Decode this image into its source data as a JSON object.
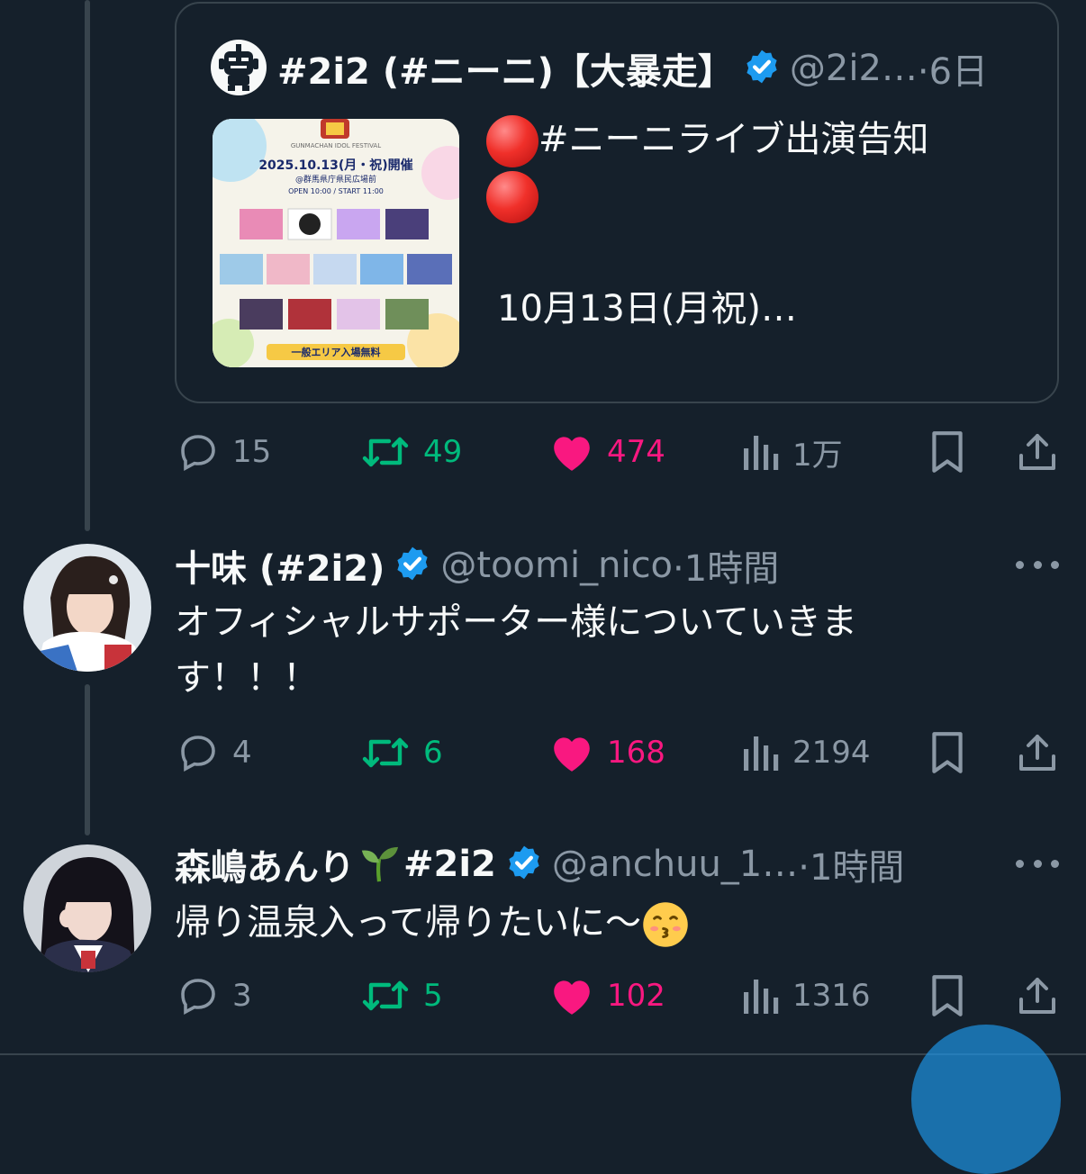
{
  "quote": {
    "name": "#2i2 (#ニーニ)【大暴走】",
    "handle": "@2i2…",
    "time": "·6日",
    "line1": "#ニーニライブ出演告知",
    "line2": "10月13日(月祝)…",
    "poster": {
      "title": "GUNMACHAN IDOL FESTIVAL",
      "date": "2025.10.13(月・祝)開催",
      "venue": "@群馬県庁県民広場前",
      "time": "OPEN 10:00 / START 11:00",
      "footer": "一般エリア入場無料"
    }
  },
  "quote_actions": {
    "replies": "15",
    "reposts": "49",
    "likes": "474",
    "views": "1万"
  },
  "tweets": [
    {
      "name": "十味 (#2i2)",
      "handle": "@toomi_nico",
      "time": "·1時間",
      "text_line1": "オフィシャルサポーター様についていきま",
      "text_line2": "す！！！",
      "actions": {
        "replies": "4",
        "reposts": "6",
        "likes": "168",
        "views": "2194"
      }
    },
    {
      "name": "森嶋あんり",
      "name_tag": "#2i2",
      "handle": "@anchuu_1…",
      "time": "·1時間",
      "text": "帰り温泉入って帰りたいに〜",
      "actions": {
        "replies": "3",
        "reposts": "5",
        "likes": "102",
        "views": "1316"
      }
    }
  ],
  "colors": {
    "background": "#15202b",
    "text": "#f7f9f9",
    "muted": "#8b98a5",
    "verified": "#1d9bf0",
    "repost": "#00ba7c",
    "like": "#f91880",
    "border": "#38444d"
  },
  "icons": [
    "reply-icon",
    "repost-icon",
    "like-icon",
    "views-icon",
    "bookmark-icon",
    "share-icon",
    "verified-badge-icon",
    "more-icon",
    "sprout-emoji",
    "kissing-emoji",
    "red-circle-emoji"
  ]
}
